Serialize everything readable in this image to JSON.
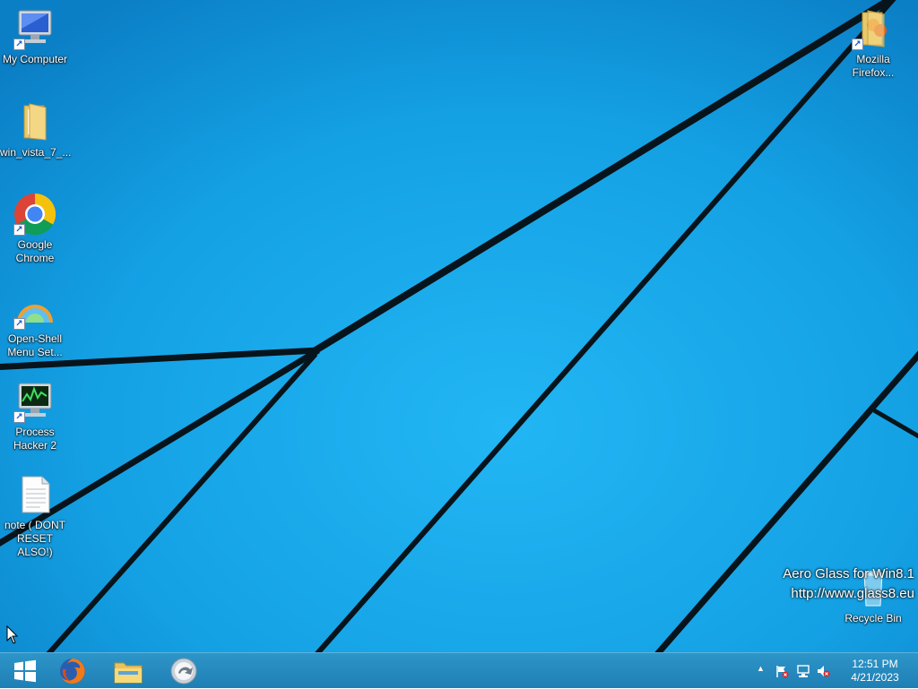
{
  "desktop": {
    "icons": [
      {
        "label": "My Computer",
        "icon": "computer-icon"
      },
      {
        "label": "win_vista_7_...",
        "icon": "folder-icon"
      },
      {
        "label": "Google Chrome",
        "icon": "chrome-icon"
      },
      {
        "label": "Open-Shell Menu Set...",
        "icon": "open-shell-icon"
      },
      {
        "label": "Process Hacker 2",
        "icon": "process-hacker-icon"
      },
      {
        "label": "note ( DONT RESET ALSO!)",
        "icon": "text-file-icon"
      },
      {
        "label": "Mozilla Firefox...",
        "icon": "folder-icon"
      },
      {
        "label": "Recycle Bin",
        "icon": "recycle-bin-icon"
      }
    ],
    "watermark": {
      "line1": "Aero Glass for Win8.1",
      "line2": "http://www.glass8.eu"
    },
    "wallpaper_color": "#1aa3e6"
  },
  "taskbar": {
    "pinned": [
      {
        "name": "Start",
        "icon": "windows-logo-icon"
      },
      {
        "name": "Firefox",
        "icon": "firefox-icon"
      },
      {
        "name": "File Explorer",
        "icon": "folder-icon"
      },
      {
        "name": "Open-Shell",
        "icon": "open-shell-icon"
      }
    ],
    "tray": {
      "icons": [
        "show-hidden-icons-icon",
        "action-center-flag-icon",
        "network-icon",
        "volume-muted-icon"
      ],
      "time": "12:51 PM",
      "date": "4/21/2023"
    }
  }
}
